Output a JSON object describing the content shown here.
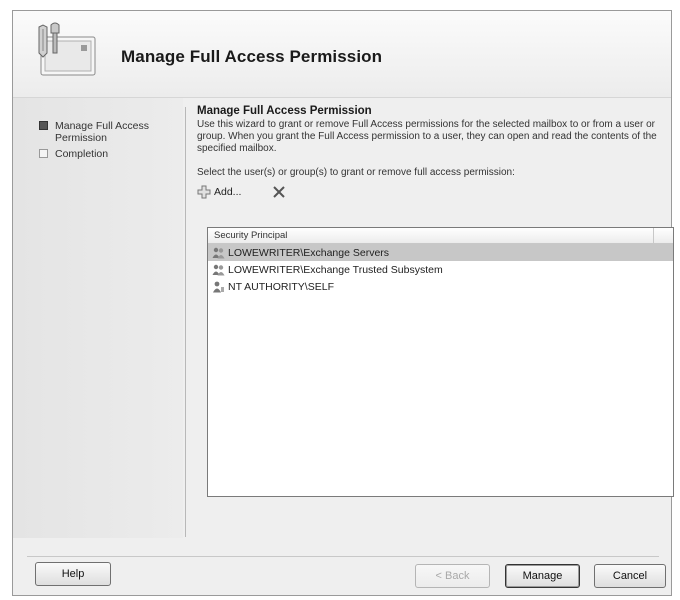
{
  "header": {
    "title": "Manage Full Access Permission",
    "icon": "mailbox-permission-icon"
  },
  "sidebar": {
    "steps": [
      {
        "label": "Manage Full Access Permission",
        "state": "current"
      },
      {
        "label": "Completion",
        "state": "pending"
      }
    ]
  },
  "main": {
    "section_title": "Manage Full Access Permission",
    "description": "Use this wizard to grant or remove Full Access permissions for the selected mailbox to or from a user or group. When you grant the Full Access permission to a user, they can open and read the contents of the specified mailbox.",
    "select_label": "Select the user(s) or group(s) to grant or remove full access permission:",
    "toolbar": {
      "add_label": "Add...",
      "add_icon": "add-icon",
      "remove_icon": "delete-icon"
    },
    "list": {
      "columns": [
        "Security Principal"
      ],
      "rows": [
        {
          "name": "LOWEWRITER\\Exchange Servers",
          "icon": "group-icon",
          "selected": true
        },
        {
          "name": "LOWEWRITER\\Exchange Trusted Subsystem",
          "icon": "group-icon",
          "selected": false
        },
        {
          "name": "NT AUTHORITY\\SELF",
          "icon": "user-icon",
          "selected": false
        }
      ]
    }
  },
  "footer": {
    "help_label": "Help",
    "back_label": "< Back",
    "manage_label": "Manage",
    "cancel_label": "Cancel"
  }
}
